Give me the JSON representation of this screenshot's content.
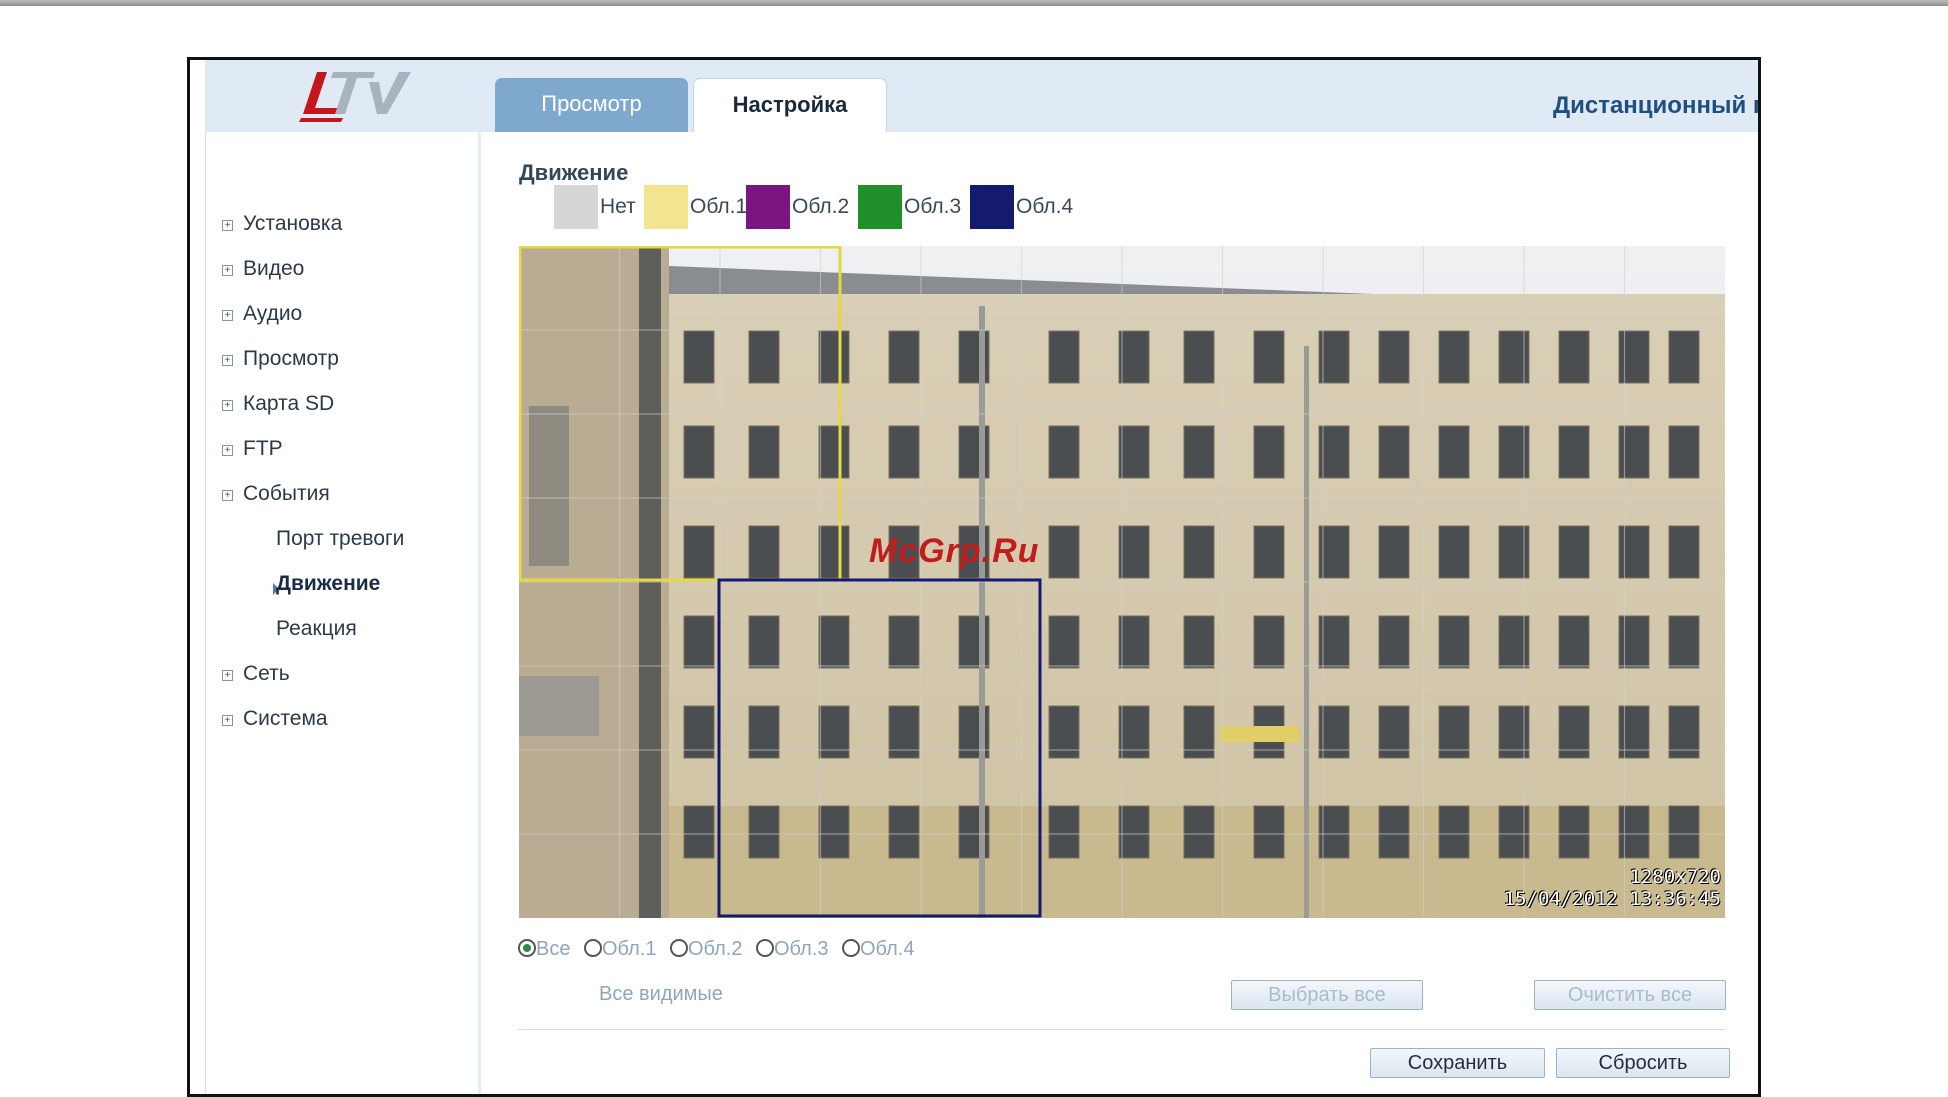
{
  "header": {
    "tabs": [
      {
        "label": "Просмотр",
        "active": false
      },
      {
        "label": "Настройка",
        "active": true
      }
    ],
    "title": "Дистанционный пр"
  },
  "sidebar": {
    "items": [
      {
        "label": "Установка",
        "level": 1,
        "active": false
      },
      {
        "label": "Видео",
        "level": 1,
        "active": false
      },
      {
        "label": "Аудио",
        "level": 1,
        "active": false
      },
      {
        "label": "Просмотр",
        "level": 1,
        "active": false
      },
      {
        "label": "Карта SD",
        "level": 1,
        "active": false
      },
      {
        "label": "FTP",
        "level": 1,
        "active": false
      },
      {
        "label": "События",
        "level": 1,
        "active": false
      },
      {
        "label": "Порт тревоги",
        "level": 2,
        "active": false
      },
      {
        "label": "Движение",
        "level": 2,
        "active": true
      },
      {
        "label": "Реакция",
        "level": 2,
        "active": false
      },
      {
        "label": "Сеть",
        "level": 1,
        "active": false
      },
      {
        "label": "Система",
        "level": 1,
        "active": false
      }
    ]
  },
  "main": {
    "section_title": "Движение",
    "legend": [
      {
        "label": "Нет",
        "color": "#d6d6d6"
      },
      {
        "label": "Обл.1",
        "color": "#f3e58f"
      },
      {
        "label": "Обл.2",
        "color": "#7b1582"
      },
      {
        "label": "Обл.3",
        "color": "#1f8f2a"
      },
      {
        "label": "Обл.4",
        "color": "#141a6e"
      }
    ],
    "camera": {
      "resolution": "1280x720",
      "timestamp": "15/04/2012 13:36:45",
      "watermark": "McGrp.Ru"
    },
    "region_colors": {
      "area1": "#e6d840",
      "area4": "#141a6e"
    },
    "radio_options": [
      {
        "label": "Все",
        "checked": true
      },
      {
        "label": "Обл.1",
        "checked": false
      },
      {
        "label": "Обл.2",
        "checked": false
      },
      {
        "label": "Обл.3",
        "checked": false
      },
      {
        "label": "Обл.4",
        "checked": false
      }
    ],
    "all_visible_label": "Все видимые",
    "select_all_label": "Выбрать все",
    "clear_all_label": "Очистить все",
    "save_label": "Сохранить",
    "reset_label": "Сбросить"
  }
}
